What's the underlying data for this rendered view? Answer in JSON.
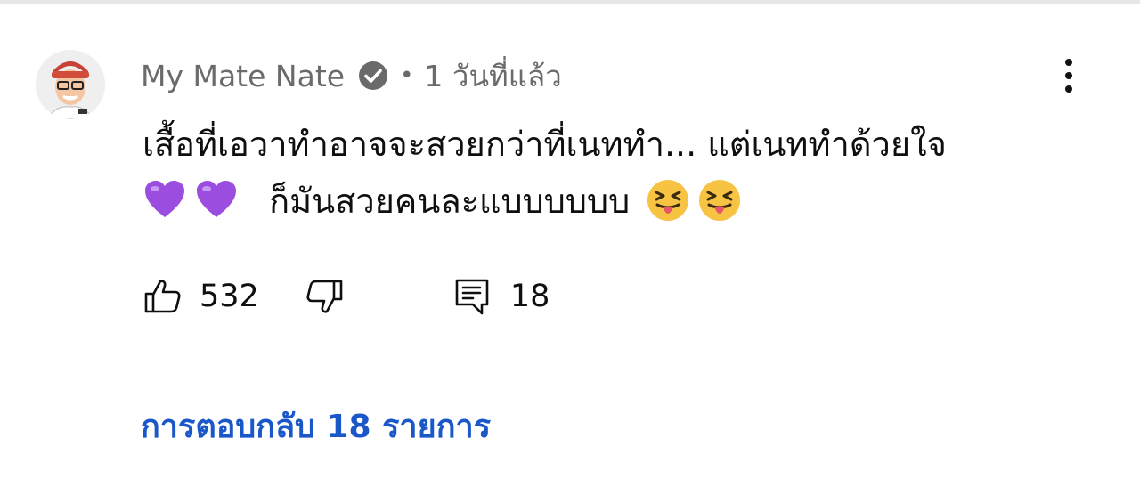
{
  "comment": {
    "author": "My Mate Nate",
    "separator": "•",
    "timestamp": "1 วันที่แล้ว",
    "text_line1": "เสื้อที่เอวาทำอาจจะสวยกว่าที่เนททำ... แต่เนททำด้วยใจ",
    "text_line2": "ก็มันสวยคนละแบบบบบบ",
    "likes": "532",
    "reply_count": "18",
    "replies_label": "การตอบกลับ 18 รายการ"
  },
  "icons": {
    "avatar": "avatar",
    "verified": "verified-check-icon",
    "more": "more-vertical-icon",
    "like": "thumbs-up-icon",
    "dislike": "thumbs-down-icon",
    "reply": "reply-comment-icon",
    "heart": "purple-heart-emoji",
    "tongue": "squinting-tongue-emoji"
  },
  "colors": {
    "link": "#1a57c9",
    "muted": "#6a6a6a",
    "text": "#0f0f0f",
    "heart": "#9b4de0"
  }
}
